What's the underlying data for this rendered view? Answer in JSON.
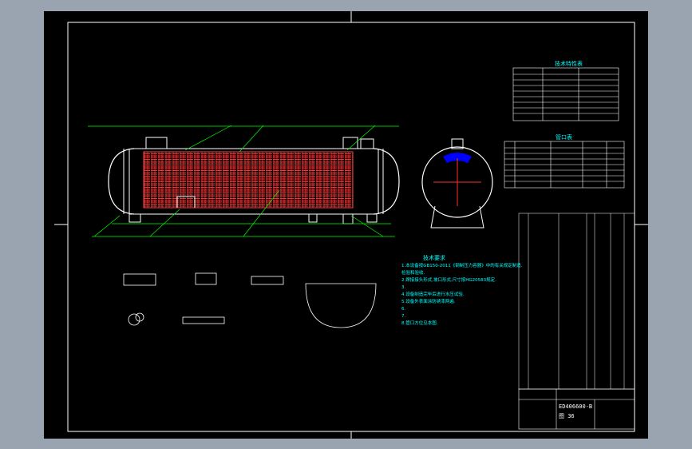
{
  "drawing": {
    "tables": {
      "design_data_title": "技术特性表",
      "nozzle_table_title": "管口表"
    },
    "notes": {
      "title": "技术要求",
      "lines": [
        "1.本设备按GB150-2011《钢制压力容器》中的有关规定制造.",
        "检验和验收.",
        "2.焊接接头形式,坡口形式,尺寸按HG20583规定.",
        "3.",
        "4.设备制造完毕后进行水压试验.",
        "5.设备外表面涂防锈漆两遍.",
        "6.",
        "7.",
        "8.管口方位见本图."
      ]
    },
    "title_block": {
      "drawing_number": "ED406600-B",
      "sheet_label": "图 36"
    },
    "colors": {
      "sheet": "#000000",
      "frame": "#ffffff",
      "lines": "#00ff00",
      "tubes": "#ff2020",
      "text": "#00ffff",
      "accent": "#0000ff"
    }
  }
}
